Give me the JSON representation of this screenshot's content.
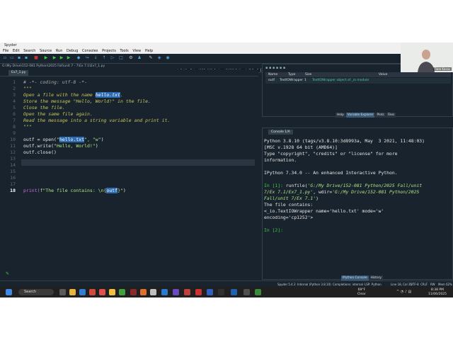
{
  "window": {
    "title": "Spyder",
    "menus": [
      "File",
      "Edit",
      "Search",
      "Source",
      "Run",
      "Debug",
      "Consoles",
      "Projects",
      "Tools",
      "View",
      "Help"
    ],
    "path": "G:\\My Drive\\152-081 Python\\2025 Fall\\unit 7\\Ex 7.1"
  },
  "editor": {
    "file_path": "G:\\My Drive\\152-081 Python\\2025 Fall\\unit 7 - 7\\Ex 7.1\\Ex7_1.py",
    "tab_label": "Ex7_1.py",
    "current_line": 18,
    "line_numbers": [
      "1",
      "2",
      "3",
      "4",
      "5",
      "6",
      "7",
      "8",
      "9",
      "10",
      "11",
      "12",
      "13",
      "14",
      "15",
      "16",
      "17",
      "18"
    ],
    "lines": {
      "l1": "# -*- coding: utf-8 -*-",
      "l2": "\"\"\"",
      "l3a": "Open a file with the name ",
      "l3b": "hello.txt",
      "l3c": ".",
      "l4": "Store the message \"Hello, World!\" in the file.",
      "l5": "Close the file.",
      "l6": "Open the same file again.",
      "l7": "Read the message into a string variable and print it.",
      "l8": "\"\"\"",
      "l10a": "outf = open(",
      "l10b": "\"",
      "l10c": "hello.txt",
      "l10d": "\", \"w\"",
      "l10e": ")",
      "l11a": "outf.write(",
      "l11b": "\"Hello, World!\"",
      "l11c": ")",
      "l12": "outf.close()",
      "l18a": "print(",
      "l18b": "f\"The file contains: \\n{",
      "l18c": "outf",
      "l18d": "}\"",
      "l18e": ")"
    }
  },
  "variable_explorer": {
    "headers": {
      "name": "Name",
      "type": "Type",
      "size": "Size",
      "value": "Value"
    },
    "rows": [
      {
        "name": "outf",
        "type": "TextIOWrapper",
        "size": "1",
        "value": "TextIOWrapper object of _io module"
      }
    ],
    "tabs": [
      "Help",
      "Variable Explorer",
      "Plots",
      "Files"
    ]
  },
  "console": {
    "tab_label": "Console 1/A",
    "lines": {
      "c1": "Python 3.8.10 (tags/v3.8.10:3d8993a, May  3 2021, 11:48:03)",
      "c2": "[MSC v.1928 64 bit (AMD64)]",
      "c3": "Type \"copyright\", \"credits\" or \"license\" for more",
      "c4": "information.",
      "c6": "IPython 7.34.0 -- An enhanced Interactive Python.",
      "c8p": "In [1]:",
      "c8a": " runfile(",
      "c8b": "'G:/My Drive/152-081 Python/2025 Fall/unit",
      "c9": "7/Ex 7.1/Ex7_1.py'",
      "c9b": ", wdir=",
      "c9c": "'G:/My Drive/152-081 Python/2025",
      "c10": "Fall/unit 7/Ex 7.1'",
      "c10b": ")",
      "c11": "The file contains:",
      "c12": "<_io.TextIOWrapper name='hello.txt' mode='w'",
      "c13": "encoding='cp1252'>",
      "c15p": "In [2]:"
    },
    "bottom_tabs": [
      "IPython Console",
      "History"
    ]
  },
  "statusbar": {
    "spyder": "Spyder 5.4.3",
    "interp": "Internal (Python 3.8.10)",
    "completions": "Completions: internal",
    "lsp": "LSP: Python",
    "position": "Line 18, Col 35",
    "encoding": "UTF-8",
    "eol": "CRLF",
    "rw": "RW",
    "mem": "Mem 62%"
  },
  "taskbar": {
    "search": "Search",
    "weather_temp": "69°F",
    "weather_desc": "Clear",
    "time": "8:38 PM",
    "date": "11/06/2025"
  },
  "webcam": {
    "name": "Tabb Kasos"
  }
}
